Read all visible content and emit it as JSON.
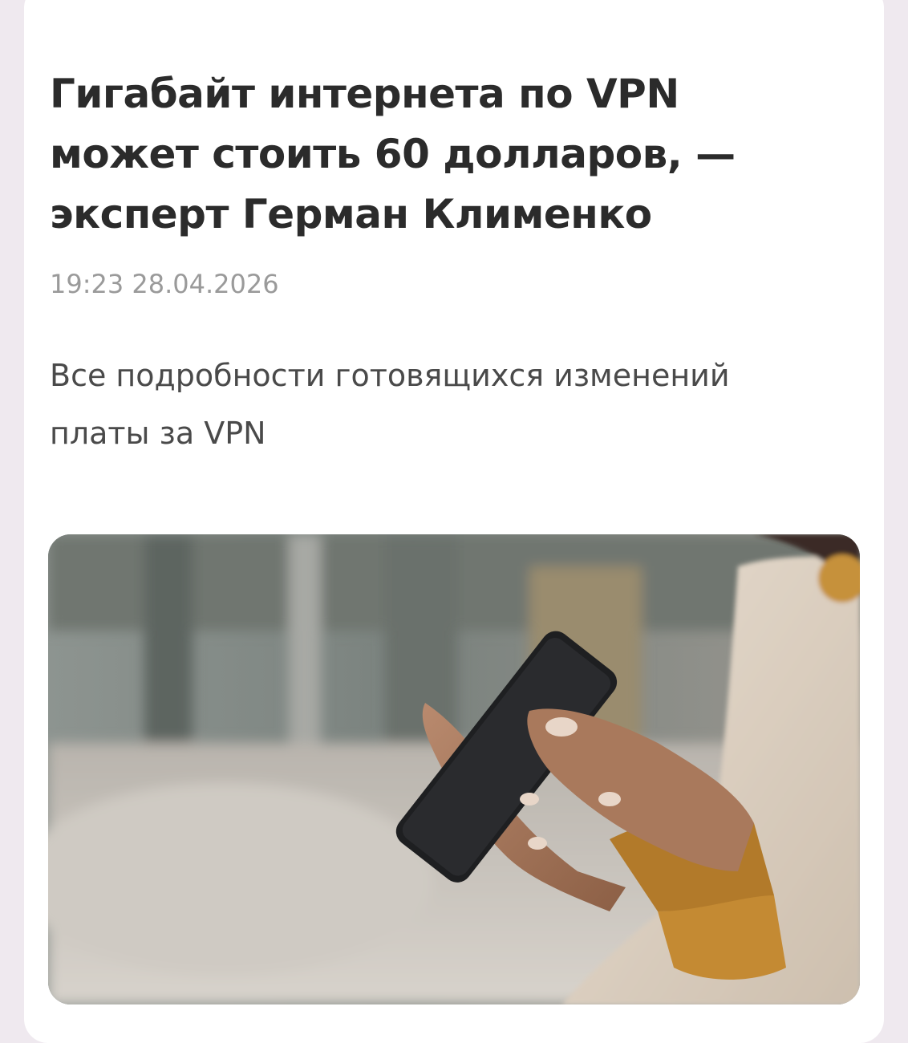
{
  "article": {
    "title": "Гигабайт интернета по VPN может стоить 60 долларов, — эксперт Герман Клименко",
    "timestamp": "19:23 28.04.2026",
    "lead": "Все подробности готовящихся изменений платы за VPN"
  },
  "image": {
    "subject": "person-using-smartphone"
  },
  "colors": {
    "background": "#efe9ef",
    "card": "#ffffff",
    "title": "#2b2b2b",
    "timestamp": "#9a9a9a",
    "lead": "#4a4a4a"
  }
}
